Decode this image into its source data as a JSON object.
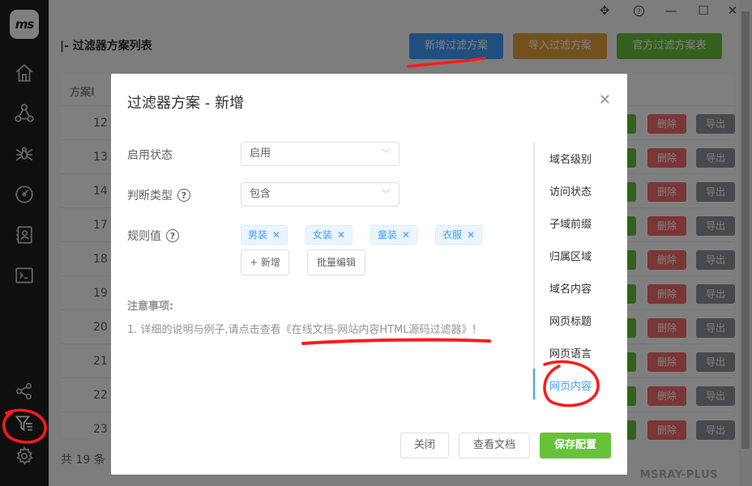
{
  "app": {
    "logo_text": "ms",
    "brand": "MSRAY-PLUS"
  },
  "sidebar": {
    "icons": [
      "home-icon",
      "network-icon",
      "spider-icon",
      "gauge-icon",
      "contacts-icon",
      "terminal-icon",
      "share-icon",
      "filter-icon",
      "gear-icon"
    ]
  },
  "window_controls": [
    "move-icon",
    "help-icon",
    "minimize-icon",
    "maximize-icon",
    "close-icon"
  ],
  "page": {
    "title": "|- 过滤器方案列表",
    "buttons": {
      "add": "新增过滤方案",
      "import": "导入过滤方案",
      "official": "官方过滤方案表"
    },
    "table": {
      "column_header": "方案I",
      "rows": [
        "12",
        "13",
        "14",
        "17",
        "18",
        "19",
        "20",
        "21",
        "22",
        "23"
      ],
      "delete_label": "删除",
      "export_label": "导出"
    },
    "total": "共 19 条"
  },
  "modal": {
    "title": "过滤器方案 - 新增",
    "fields": {
      "status": {
        "label": "启用状态",
        "value": "启用"
      },
      "type": {
        "label": "判断类型",
        "value": "包含"
      },
      "rule": {
        "label": "规则值",
        "tags": [
          "男装",
          "女装",
          "童装",
          "衣服"
        ]
      }
    },
    "add_button": "+ 新增",
    "batch_button": "批量编辑",
    "notes_title": "注意事项:",
    "notes_line": "1. 详细的说明与例子,请点击查看",
    "notes_link": "《在线文档-网站内容HTML源码过滤器》",
    "notes_end": "!",
    "side_menu": [
      "域名级别",
      "访问状态",
      "子域前缀",
      "归属区域",
      "域名内容",
      "网页标题",
      "网页语言",
      "网页内容"
    ],
    "active_side": "网页内容",
    "footer": {
      "close": "关闭",
      "docs": "查看文档",
      "save": "保存配置"
    }
  },
  "colors": {
    "primary": "#409eff",
    "success": "#67c23a",
    "warning": "#e6a23c",
    "danger": "#f56c6c",
    "annotation": "#ff1a1a"
  }
}
